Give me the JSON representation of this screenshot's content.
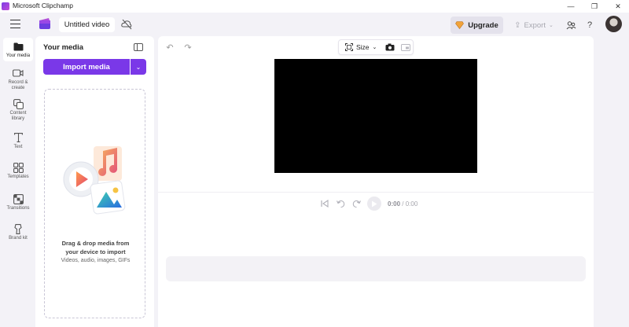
{
  "window": {
    "title": "Microsoft Clipchamp",
    "controls": [
      "minimize",
      "restore",
      "close"
    ]
  },
  "header": {
    "project_title": "Untitled video",
    "upgrade_label": "Upgrade",
    "export_label": "Export",
    "help_label": "?"
  },
  "nav": {
    "items": [
      {
        "label": "Your media",
        "icon": "folder-icon",
        "active": true
      },
      {
        "label": "Record & create",
        "icon": "camera-icon",
        "active": false
      },
      {
        "label": "Content library",
        "icon": "library-icon",
        "active": false
      },
      {
        "label": "Text",
        "icon": "text-icon",
        "active": false
      },
      {
        "label": "Templates",
        "icon": "templates-icon",
        "active": false
      },
      {
        "label": "Transitions",
        "icon": "transitions-icon",
        "active": false
      },
      {
        "label": "Brand kit",
        "icon": "brand-kit-icon",
        "active": false
      }
    ]
  },
  "media": {
    "title": "Your media",
    "import_label": "Import media",
    "drop_line1": "Drag & drop media from",
    "drop_line2": "your device to import",
    "drop_sub": "Videos, audio, images, GIFs"
  },
  "editor": {
    "size_label": "Size",
    "current_time": "0:00",
    "total_time": "/ 0:00"
  },
  "colors": {
    "accent": "#7a38e8",
    "background": "#f3f2f7",
    "preview": "#000000"
  }
}
